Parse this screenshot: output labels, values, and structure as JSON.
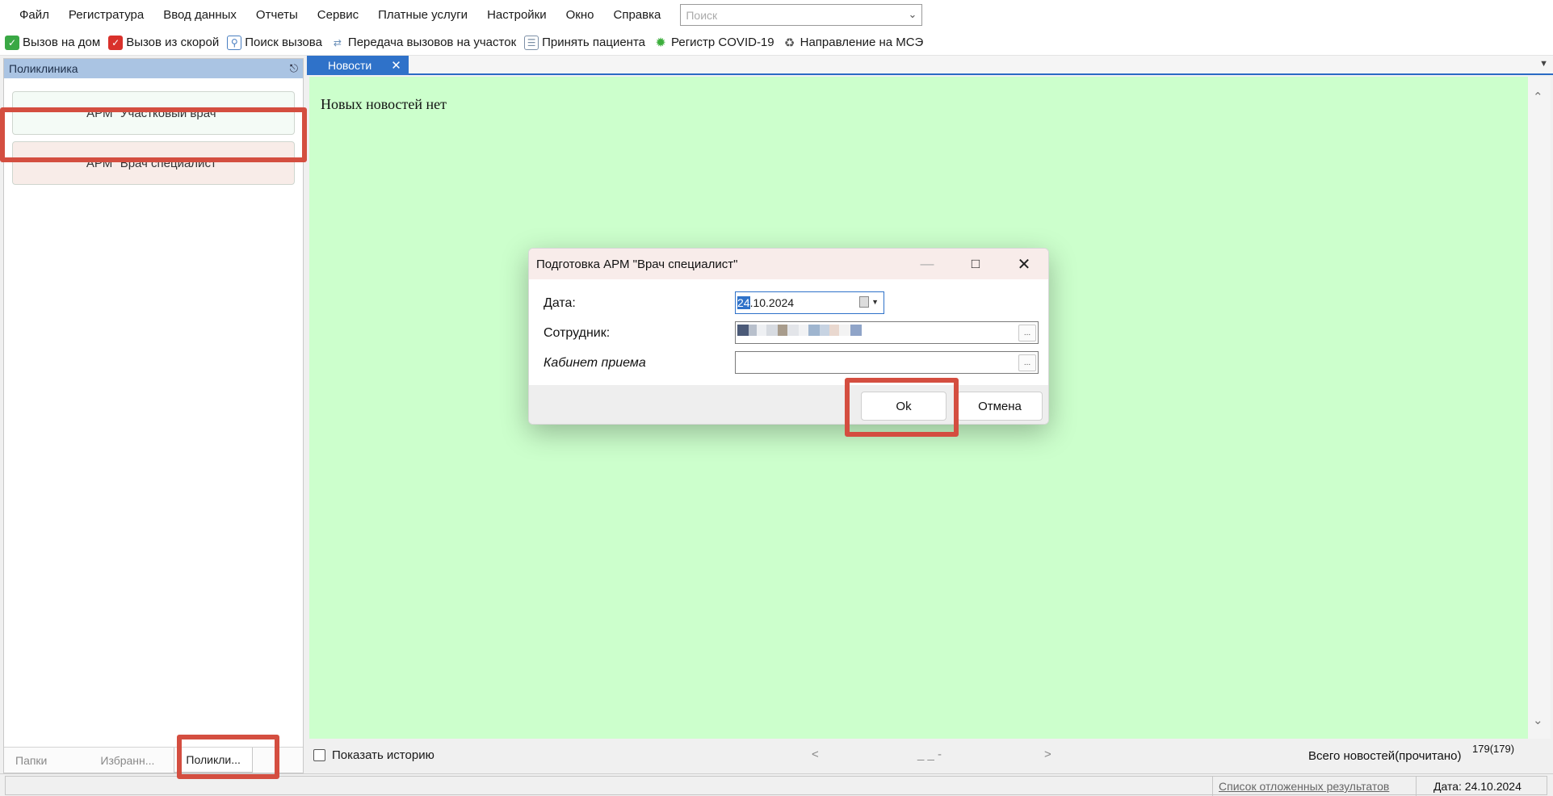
{
  "menu": {
    "items": [
      "Файл",
      "Регистратура",
      "Ввод данных",
      "Отчеты",
      "Сервис",
      "Платные услуги",
      "Настройки",
      "Окно",
      "Справка"
    ],
    "search_placeholder": "Поиск"
  },
  "toolbar": {
    "buttons": [
      {
        "label": "Вызов на дом",
        "icon": "house-call-icon",
        "color": "#3aa845"
      },
      {
        "label": "Вызов из скорой",
        "icon": "ambulance-call-icon",
        "color": "#d9312b"
      },
      {
        "label": "Поиск вызова",
        "icon": "search-call-icon",
        "color": "#4a7fc1"
      },
      {
        "label": "Передача вызовов на участок",
        "icon": "transfer-calls-icon",
        "color": "#6a8fb8"
      },
      {
        "label": "Принять пациента",
        "icon": "accept-patient-icon",
        "color": "#7c8fa6"
      },
      {
        "label": "Регистр COVID-19",
        "icon": "covid-icon",
        "color": "#3cae3c"
      },
      {
        "label": "Направление на МСЭ",
        "icon": "mse-referral-icon",
        "color": "#555555"
      }
    ]
  },
  "left_panel": {
    "title": "Поликлиника",
    "arm_buttons": [
      "АРМ \"Участковый врач\"",
      "АРМ \"Врач специалист\""
    ],
    "tabs": [
      "Папки",
      "Избранн...",
      "Поликли..."
    ]
  },
  "doc": {
    "tab_label": "Новости",
    "news_text": "Новых новостей нет",
    "show_history": "Показать историю",
    "pager_prev": "<",
    "pager_mid": "_ _ -",
    "pager_next": ">",
    "total_label": "Всего новостей(прочитано)",
    "total_count": "179(179)"
  },
  "status": {
    "postponed_link": "Список отложенных результатов",
    "date": "Дата: 24.10.2024"
  },
  "modal": {
    "title": "Подготовка АРМ \"Врач специалист\"",
    "date_label": "Дата:",
    "date_day": "24",
    "date_rest": ".10.2024",
    "employee_label": "Сотрудник:",
    "cabinet_label": "Кабинет приема",
    "ok": "Ok",
    "cancel": "Отмена"
  },
  "colors": {
    "highlight": "#d44e40",
    "news_bg": "#ccffcc",
    "tab_blue": "#2f72c9"
  }
}
